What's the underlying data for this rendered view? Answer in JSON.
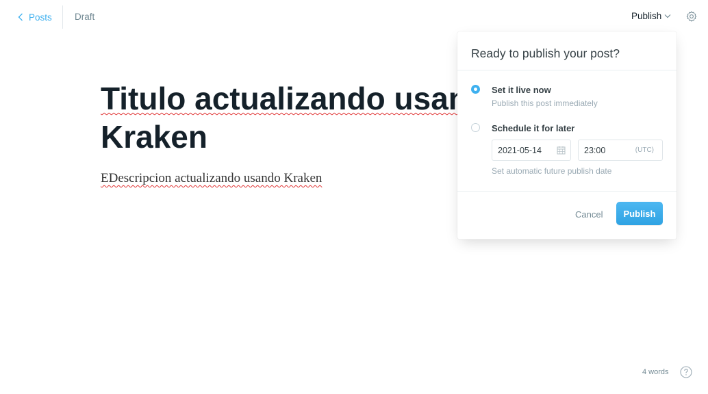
{
  "header": {
    "back_label": "Posts",
    "status": "Draft",
    "publish_menu_label": "Publish"
  },
  "editor": {
    "title_line1": "Titulo actualizando usan",
    "title_line2": "Kraken",
    "body": "EDescripcion actualizando usando Kraken"
  },
  "publish_popover": {
    "heading": "Ready to publish your post?",
    "options": [
      {
        "label": "Set it live now",
        "description": "Publish this post immediately",
        "selected": true
      },
      {
        "label": "Schedule it for later",
        "selected": false
      }
    ],
    "schedule": {
      "date": "2021-05-14",
      "time": "23:00",
      "timezone": "(UTC)",
      "hint": "Set automatic future publish date"
    },
    "cancel_label": "Cancel",
    "publish_label": "Publish"
  },
  "footer": {
    "word_count": "4 words"
  },
  "colors": {
    "accent": "#3eb0ef",
    "text": "#15212a",
    "muted": "#738a94"
  }
}
